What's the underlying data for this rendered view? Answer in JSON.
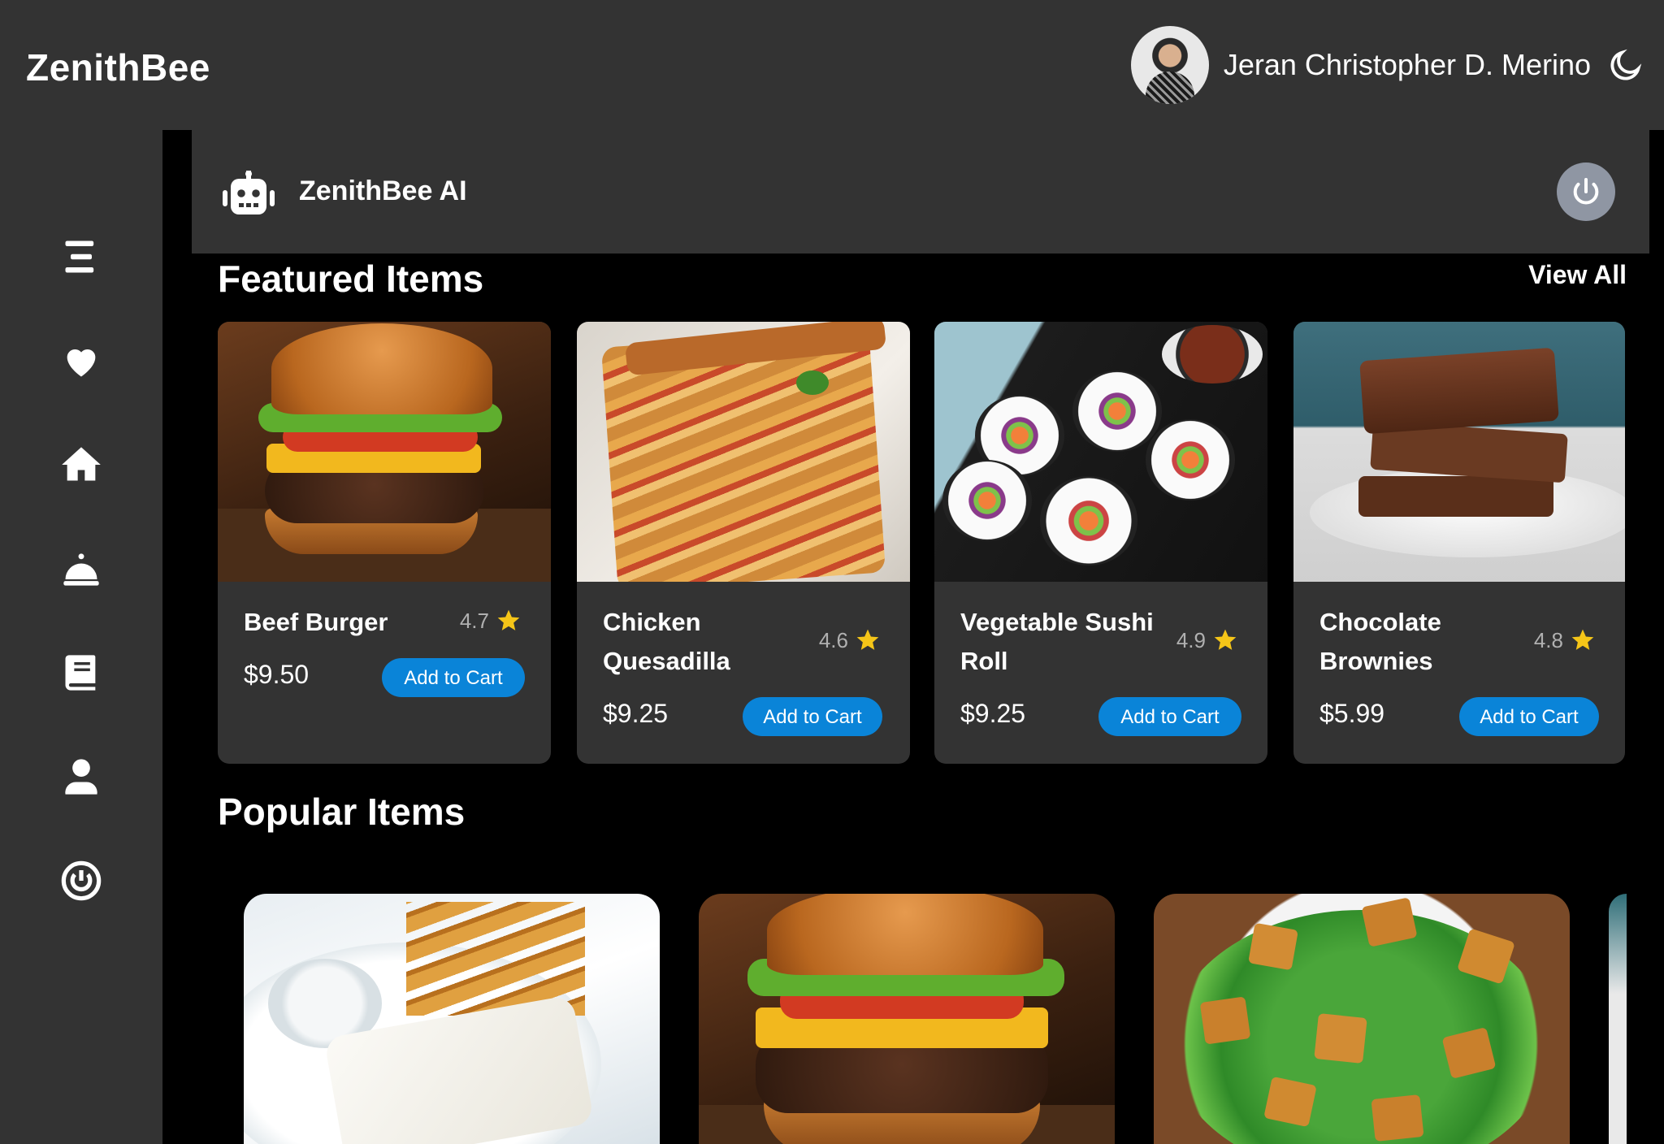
{
  "header": {
    "brand": "ZenithBee",
    "user_name": "Jeran Christopher D. Merino"
  },
  "sidebar": {
    "items": [
      {
        "icon": "menu-icon"
      },
      {
        "icon": "heart-icon"
      },
      {
        "icon": "home-icon"
      },
      {
        "icon": "service-bell-icon"
      },
      {
        "icon": "book-icon"
      },
      {
        "icon": "user-icon"
      },
      {
        "icon": "power-icon"
      }
    ]
  },
  "ai_panel": {
    "title": "ZenithBee AI"
  },
  "featured": {
    "title": "Featured Items",
    "view_all": "View All",
    "items": [
      {
        "name": "Beef Burger",
        "rating": "4.7",
        "price": "$9.50",
        "button": "Add to Cart"
      },
      {
        "name": "Chicken Quesadilla",
        "rating": "4.6",
        "price": "$9.25",
        "button": "Add to Cart"
      },
      {
        "name": "Vegetable Sushi Roll",
        "rating": "4.9",
        "price": "$9.25",
        "button": "Add to Cart"
      },
      {
        "name": "Chocolate Brownies",
        "rating": "4.8",
        "price": "$5.99",
        "button": "Add to Cart"
      }
    ]
  },
  "popular": {
    "title": "Popular Items"
  },
  "colors": {
    "background": "#000000",
    "surface": "#333333",
    "accent_button": "#0a84d8",
    "star": "#f5c518"
  }
}
